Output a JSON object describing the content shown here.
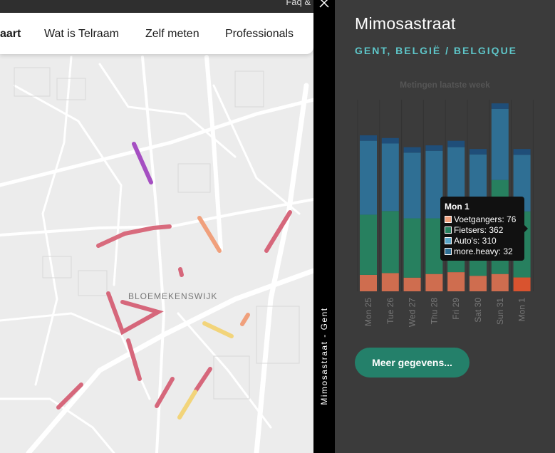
{
  "topbar": {
    "faq": "Faq &"
  },
  "nav": {
    "items": [
      "aart",
      "Wat is Telraam",
      "Zelf meten",
      "Professionals"
    ]
  },
  "map": {
    "area_label": "BLOEMEKENSWIJK"
  },
  "sidebar_strip": {
    "label": "Mimosastraat - Gent"
  },
  "panel": {
    "street": "Mimosastraat",
    "city": "GENT, BELGIË / BELGIQUE",
    "more_button": "Meer gegevens..."
  },
  "tooltip": {
    "title": "Mon 1",
    "rows": [
      "Voetgangers: 76",
      "Fietsers: 362",
      "Auto's: 310",
      "more.heavy: 32"
    ]
  },
  "colors": {
    "pedestrians": "#cf6d4f",
    "cyclists": "#27805f",
    "cars": "#2f6f94",
    "heavy": "#1f4e79",
    "accent": "#5ec6c9",
    "button": "#24806a"
  },
  "chart_data": {
    "type": "bar",
    "title": "Metingen laatste week",
    "categories": [
      "Mon 25",
      "Tue 26",
      "Wed 27",
      "Thu 28",
      "Fri 29",
      "Sat 30",
      "Sun 31",
      "Mon 1"
    ],
    "stacked": true,
    "series": [
      {
        "name": "Voetgangers",
        "color": "#cf6d4f",
        "values": [
          90,
          100,
          75,
          95,
          105,
          85,
          95,
          76
        ]
      },
      {
        "name": "Fietsers",
        "color": "#27805f",
        "values": [
          330,
          340,
          325,
          305,
          280,
          310,
          515,
          362
        ]
      },
      {
        "name": "Auto's",
        "color": "#2f6f94",
        "values": [
          405,
          370,
          360,
          370,
          405,
          355,
          390,
          310
        ]
      },
      {
        "name": "more.heavy",
        "color": "#1f4e79",
        "values": [
          30,
          30,
          30,
          30,
          35,
          30,
          30,
          32
        ]
      }
    ],
    "ylim": [
      0,
      1050
    ],
    "grid": false,
    "legend": "none"
  }
}
